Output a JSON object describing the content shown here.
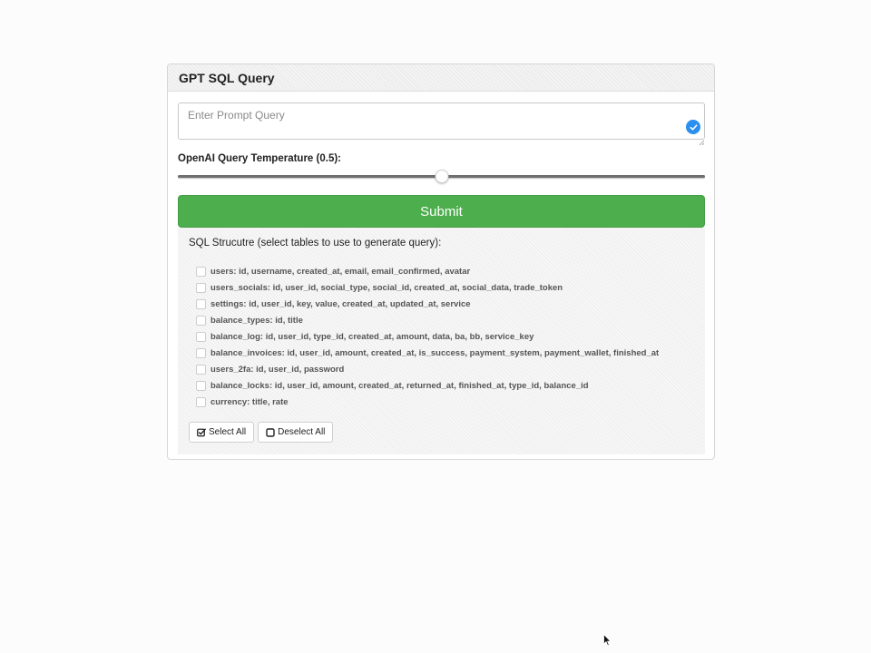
{
  "panel": {
    "title": "GPT SQL Query"
  },
  "prompt": {
    "placeholder": "Enter Prompt Query",
    "value": ""
  },
  "temperature": {
    "label": "OpenAI Query Temperature (0.5):",
    "value": 0.5,
    "min": 0,
    "max": 1
  },
  "submit": {
    "label": "Submit"
  },
  "structure": {
    "title": "SQL Strucutre (select tables to use to generate query):",
    "tables": [
      {
        "text": "users: id, username, created_at, email, email_confirmed, avatar",
        "checked": false
      },
      {
        "text": "users_socials: id, user_id, social_type, social_id, created_at, social_data, trade_token",
        "checked": false
      },
      {
        "text": "settings: id, user_id, key, value, created_at, updated_at, service",
        "checked": false
      },
      {
        "text": "balance_types: id, title",
        "checked": false
      },
      {
        "text": "balance_log: id, user_id, type_id, created_at, amount, data, ba, bb, service_key",
        "checked": false
      },
      {
        "text": "balance_invoices: id, user_id, amount, created_at, is_success, payment_system, payment_wallet, finished_at",
        "checked": false
      },
      {
        "text": "users_2fa: id, user_id, password",
        "checked": false
      },
      {
        "text": "balance_locks: id, user_id, amount, created_at, returned_at, finished_at, type_id, balance_id",
        "checked": false
      },
      {
        "text": "currency: title, rate",
        "checked": false
      }
    ],
    "select_all_label": "Select All",
    "deselect_all_label": "Deselect All"
  },
  "colors": {
    "submit": "#4cae4c",
    "badge": "#2b8ff0"
  },
  "icons": {
    "prompt_badge": "check-circle-icon",
    "select_all": "check-square-icon",
    "deselect_all": "square-icon",
    "cursor": "mouse-pointer-icon"
  }
}
